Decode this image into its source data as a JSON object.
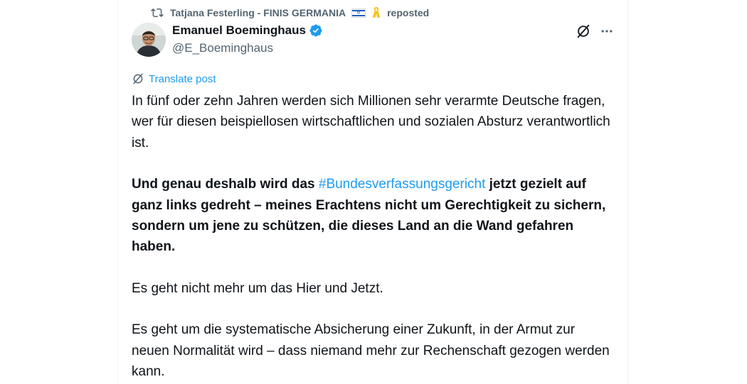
{
  "repost": {
    "reposter_name": "Tatjana Festerling - FINIS GERMANIA",
    "label": "reposted",
    "icon": "repost-icon",
    "flag_icon": "israel-flag-icon",
    "ribbon_icon": "yellow-ribbon-icon"
  },
  "author": {
    "name": "Emanuel Boeminghaus",
    "handle": "@E_Boeminghaus",
    "verified_icon": "verified-badge-icon",
    "verified_color": "#1d9bf0"
  },
  "actions": {
    "grok_icon": "grok-icon",
    "more_icon": "more-options-icon"
  },
  "translate": {
    "label": "Translate post",
    "icon": "translate-icon"
  },
  "post": {
    "para1": "In fünf oder zehn Jahren werden sich Millionen sehr verarmte Deutsche fragen, wer für diesen beispiellosen wirtschaftlichen und sozialen Absturz verantwortlich ist.",
    "para2_before": "Und genau deshalb wird das ",
    "para2_hashtag": "#Bundesverfassungsgericht",
    "para2_after": " jetzt gezielt auf ganz links gedreht – meines Erachtens nicht um Gerechtigkeit zu sichern, sondern um jene zu schützen, die dieses Land an die Wand gefahren haben.",
    "para3": "Es geht nicht mehr um das Hier und Jetzt.",
    "para4": "Es geht um die systematische Absicherung einer Zukunft, in der Armut zur neuen Normalität wird – dass niemand mehr zur Rechenschaft gezogen werden kann."
  },
  "colors": {
    "text": "#0f1419",
    "secondary": "#536471",
    "accent": "#1d9bf0"
  }
}
